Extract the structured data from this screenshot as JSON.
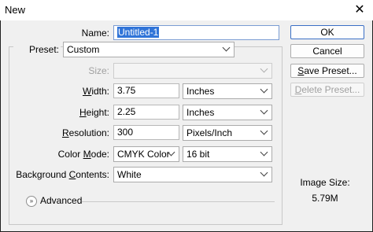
{
  "window": {
    "title": "New",
    "close_glyph": "✕"
  },
  "form": {
    "name_label": "Name:",
    "name_value": "Untitled-1",
    "preset_label": "Preset:",
    "preset_value": "Custom",
    "size_label": "Size:",
    "size_value": "",
    "width_label": "Width:",
    "width_value": "3.75",
    "width_unit": "Inches",
    "height_label": "Height:",
    "height_value": "2.25",
    "height_unit": "Inches",
    "resolution_label": "Resolution:",
    "resolution_value": "300",
    "resolution_unit": "Pixels/Inch",
    "color_mode_label": "Color Mode:",
    "color_mode_value": "CMYK Color",
    "bit_depth": "16 bit",
    "background_label": "Background Contents:",
    "background_value": "White",
    "advanced_label": "Advanced",
    "advanced_icon": "expand-chevrons-icon"
  },
  "buttons": {
    "ok": "OK",
    "cancel": "Cancel",
    "save_preset": "Save Preset...",
    "delete_preset": "Delete Preset..."
  },
  "info": {
    "image_size_label": "Image Size:",
    "image_size_value": "5.79M"
  },
  "colors": {
    "selection": "#3074d8",
    "dialog_bg": "#f0f0f0",
    "ok_border": "#3a6fc5"
  }
}
